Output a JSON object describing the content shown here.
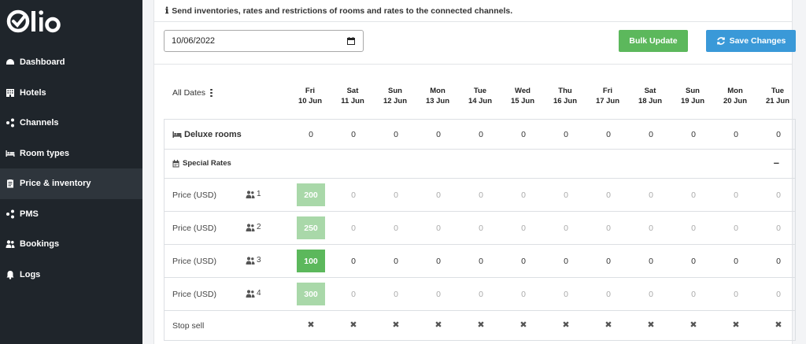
{
  "brand": {
    "name": "Qlo"
  },
  "sidebar": {
    "items": [
      {
        "label": "Dashboard",
        "icon": "dashboard-icon"
      },
      {
        "label": "Hotels",
        "icon": "building-icon"
      },
      {
        "label": "Channels",
        "icon": "share-nodes-icon"
      },
      {
        "label": "Room types",
        "icon": "bed-icon"
      },
      {
        "label": "Price & inventory",
        "icon": "clipboard-icon",
        "active": true
      },
      {
        "label": "PMS",
        "icon": "share-nodes-icon"
      },
      {
        "label": "Bookings",
        "icon": "users-icon"
      },
      {
        "label": "Logs",
        "icon": "bell-icon"
      }
    ]
  },
  "notice": {
    "text": "Send inventories, rates and restrictions of rooms and rates to the connected channels."
  },
  "toolbar": {
    "date_value": "10/06/2022",
    "bulk_update_label": "Bulk Update",
    "save_changes_label": "Save Changes"
  },
  "grid": {
    "all_dates_label": "All Dates",
    "days": [
      {
        "dow": "Fri",
        "date": "10 Jun"
      },
      {
        "dow": "Sat",
        "date": "11 Jun"
      },
      {
        "dow": "Sun",
        "date": "12 Jun"
      },
      {
        "dow": "Mon",
        "date": "13 Jun"
      },
      {
        "dow": "Tue",
        "date": "14 Jun"
      },
      {
        "dow": "Wed",
        "date": "15 Jun"
      },
      {
        "dow": "Thu",
        "date": "16 Jun"
      },
      {
        "dow": "Fri",
        "date": "17 Jun"
      },
      {
        "dow": "Sat",
        "date": "18 Jun"
      },
      {
        "dow": "Sun",
        "date": "19 Jun"
      },
      {
        "dow": "Mon",
        "date": "20 Jun"
      },
      {
        "dow": "Tue",
        "date": "21 Jun"
      }
    ],
    "room": {
      "name": "Deluxe rooms",
      "availability": [
        "0",
        "0",
        "0",
        "0",
        "0",
        "0",
        "0",
        "0",
        "0",
        "0",
        "0",
        "0"
      ]
    },
    "rate_plan": {
      "name": "Special Rates",
      "collapse_symbol": "–"
    },
    "price_rows": [
      {
        "label": "Price (USD)",
        "occupancy": "1",
        "first": "200",
        "emphasis": "light",
        "values": [
          "0",
          "0",
          "0",
          "0",
          "0",
          "0",
          "0",
          "0",
          "0",
          "0",
          "0"
        ]
      },
      {
        "label": "Price (USD)",
        "occupancy": "2",
        "first": "250",
        "emphasis": "light",
        "values": [
          "0",
          "0",
          "0",
          "0",
          "0",
          "0",
          "0",
          "0",
          "0",
          "0",
          "0"
        ]
      },
      {
        "label": "Price (USD)",
        "occupancy": "3",
        "first": "100",
        "emphasis": "dark",
        "values": [
          "0",
          "0",
          "0",
          "0",
          "0",
          "0",
          "0",
          "0",
          "0",
          "0",
          "0"
        ]
      },
      {
        "label": "Price (USD)",
        "occupancy": "4",
        "first": "300",
        "emphasis": "light",
        "values": [
          "0",
          "0",
          "0",
          "0",
          "0",
          "0",
          "0",
          "0",
          "0",
          "0",
          "0"
        ]
      }
    ],
    "stop_sell": {
      "label": "Stop sell",
      "mark": "✖"
    }
  },
  "colors": {
    "sidebar_bg": "#1f252b",
    "bulk_green": "#5cb85c",
    "save_blue": "#3a99d8"
  }
}
